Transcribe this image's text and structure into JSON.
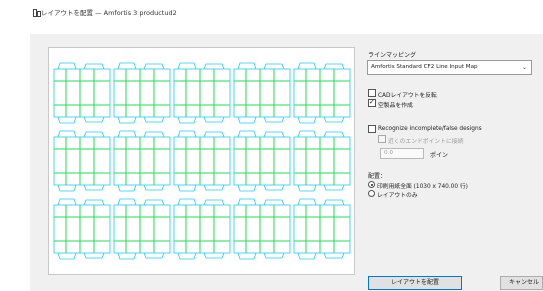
{
  "window": {
    "title": "レイアウトを配置 — Amfortis 3 productud2",
    "icon": "layout-icon"
  },
  "line_mapping": {
    "label": "ラインマッピング",
    "selected": "Amfortis Standard CF2 Line Input Map",
    "dropdown_icon": "chevron-down-icon"
  },
  "options": {
    "flip_cad": {
      "label": "CADレイアウトを反転",
      "checked": false
    },
    "create_blank": {
      "label": "空製品を作成",
      "checked": true
    }
  },
  "recognize": {
    "label": "Recognize incomplete/false designs",
    "checked": false,
    "connect_endpoints": {
      "label": "近くのエンドポイントに接続",
      "checked": false,
      "disabled": true
    },
    "tolerance_value": "0.0",
    "tolerance_unit": "ポイン"
  },
  "placement": {
    "label": "配置：",
    "options": [
      {
        "label": "印刷用紙全面 (1030 x 740.00 行)",
        "selected": true
      },
      {
        "label": "レイアウトのみ",
        "selected": false
      }
    ]
  },
  "buttons": {
    "place": "レイアウトを配置",
    "cancel": "キャンセル"
  },
  "colors": {
    "accent": "#0078d7",
    "line_green": "#22dd55",
    "line_cyan": "#22ccee"
  }
}
